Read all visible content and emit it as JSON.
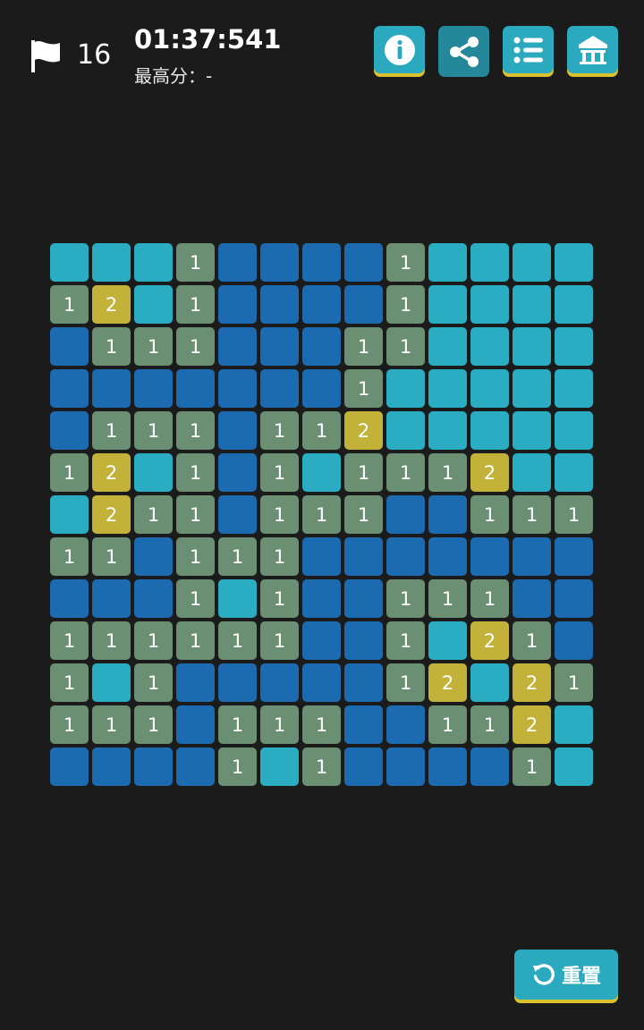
{
  "header": {
    "flag_count": "16",
    "timer": "01:37:541",
    "best_score": "最高分：-",
    "buttons": [
      {
        "icon": "info-icon"
      },
      {
        "icon": "share-icon"
      },
      {
        "icon": "list-icon"
      },
      {
        "icon": "home-icon"
      }
    ]
  },
  "board": {
    "rows": 13,
    "cols": 13,
    "legend": {
      "U": "unrevealed",
      "E": "revealed-empty",
      "1": "number-1",
      "2": "number-2"
    },
    "cells": [
      [
        "U",
        "U",
        "U",
        "1",
        "E",
        "E",
        "E",
        "E",
        "1",
        "U",
        "U",
        "U",
        "U"
      ],
      [
        "1",
        "2",
        "U",
        "1",
        "E",
        "E",
        "E",
        "E",
        "1",
        "U",
        "U",
        "U",
        "U"
      ],
      [
        "E",
        "1",
        "1",
        "1",
        "E",
        "E",
        "E",
        "1",
        "1",
        "U",
        "U",
        "U",
        "U"
      ],
      [
        "E",
        "E",
        "E",
        "E",
        "E",
        "E",
        "E",
        "1",
        "U",
        "U",
        "U",
        "U",
        "U"
      ],
      [
        "E",
        "1",
        "1",
        "1",
        "E",
        "1",
        "1",
        "2",
        "U",
        "U",
        "U",
        "U",
        "U"
      ],
      [
        "1",
        "2",
        "U",
        "1",
        "E",
        "1",
        "U",
        "1",
        "1",
        "1",
        "2",
        "U",
        "U"
      ],
      [
        "U",
        "2",
        "1",
        "1",
        "E",
        "1",
        "1",
        "1",
        "E",
        "E",
        "1",
        "1",
        "1"
      ],
      [
        "1",
        "1",
        "E",
        "1",
        "1",
        "1",
        "E",
        "E",
        "E",
        "E",
        "E",
        "E",
        "E"
      ],
      [
        "E",
        "E",
        "E",
        "1",
        "U",
        "1",
        "E",
        "E",
        "1",
        "1",
        "1",
        "E",
        "E"
      ],
      [
        "1",
        "1",
        "1",
        "1",
        "1",
        "1",
        "E",
        "E",
        "1",
        "U",
        "2",
        "1",
        "E"
      ],
      [
        "1",
        "U",
        "1",
        "E",
        "E",
        "E",
        "E",
        "E",
        "1",
        "2",
        "U",
        "2",
        "1"
      ],
      [
        "1",
        "1",
        "1",
        "E",
        "1",
        "1",
        "1",
        "E",
        "E",
        "1",
        "1",
        "2",
        "U"
      ],
      [
        "E",
        "E",
        "E",
        "E",
        "1",
        "U",
        "1",
        "E",
        "E",
        "E",
        "E",
        "1",
        "U"
      ]
    ]
  },
  "footer": {
    "reset_label": "重置"
  },
  "colors": {
    "background": "#1b1b1b",
    "unrevealed": "#2aadc2",
    "empty": "#1c6ab0",
    "number": "#6a8f72",
    "two": "#c3b23a",
    "button": "#2aa9bf",
    "button_underline": "#d9c22e"
  }
}
